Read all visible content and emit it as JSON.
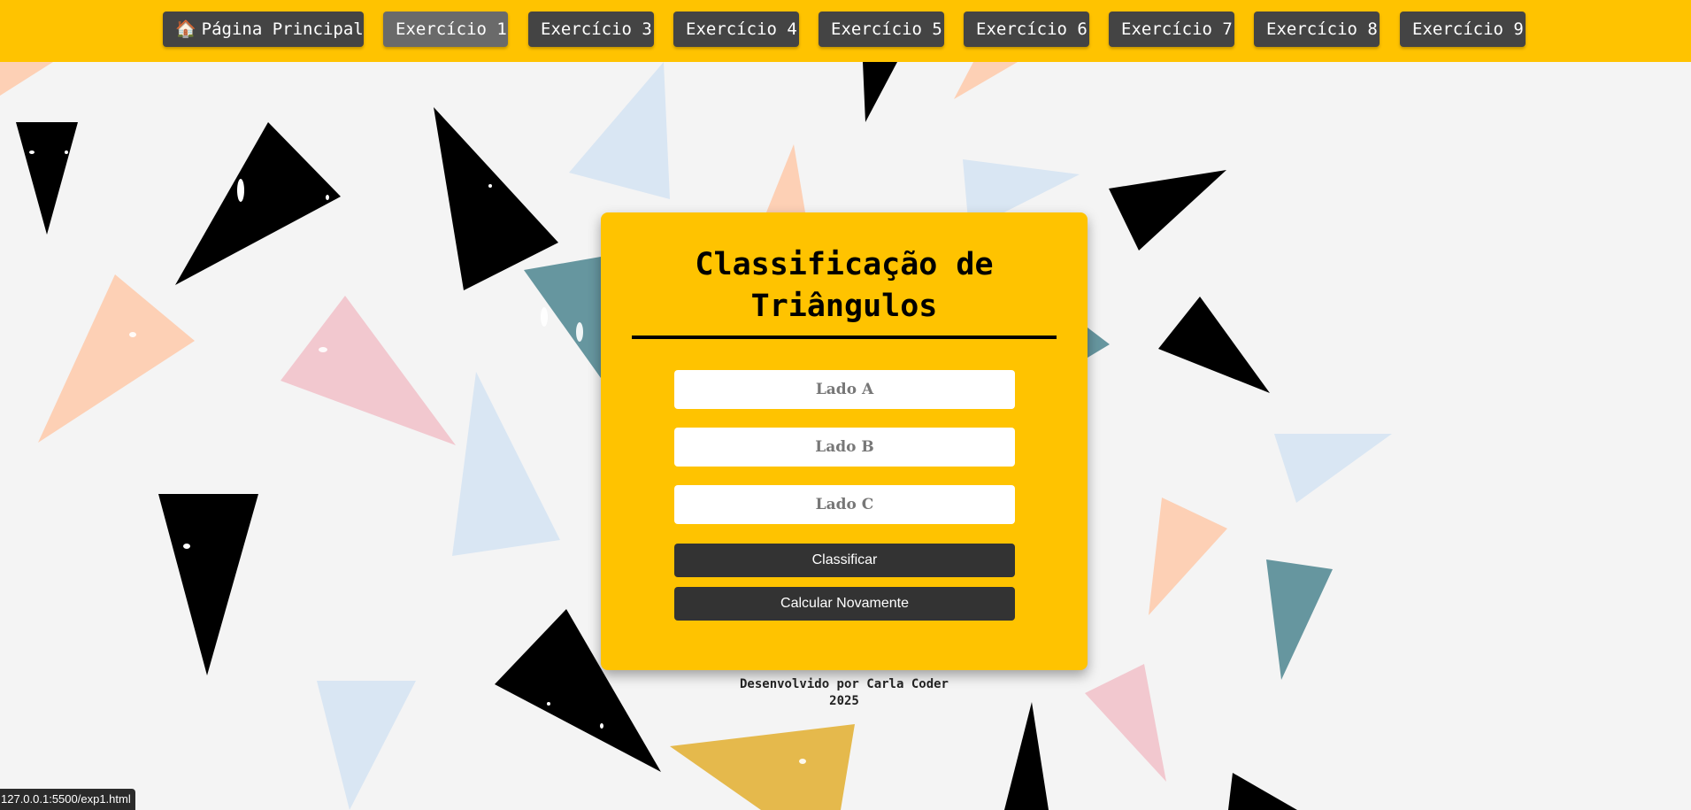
{
  "nav": {
    "home_icon": "🏠",
    "home_label": "Página Principal",
    "items": [
      {
        "label": "Exercício 1",
        "active": true
      },
      {
        "label": "Exercício 3"
      },
      {
        "label": "Exercício 4"
      },
      {
        "label": "Exercício 5"
      },
      {
        "label": "Exercício 6"
      },
      {
        "label": "Exercício 7"
      },
      {
        "label": "Exercício 8"
      },
      {
        "label": "Exercício 9"
      }
    ]
  },
  "card": {
    "title_line1": "Classificação de",
    "title_line2": "Triângulos",
    "fields": [
      {
        "placeholder": "Lado A",
        "value": ""
      },
      {
        "placeholder": "Lado B",
        "value": ""
      },
      {
        "placeholder": "Lado C",
        "value": ""
      }
    ],
    "classify_label": "Classificar",
    "reset_label": "Calcular Novamente"
  },
  "footer": {
    "credit": "Desenvolvido por Carla Coder",
    "year": "2025"
  },
  "status_bar": {
    "url": "127.0.0.1:5500/exp1.html"
  },
  "colors": {
    "accent": "#ffc300",
    "button_dark": "#333333",
    "nav_button": "#444444",
    "nav_button_active": "#6a6a6a",
    "background": "#f4f4f4",
    "triangle_black": "#000000",
    "triangle_peach": "#fdd0b5",
    "triangle_pink": "#f2c8cf",
    "triangle_lightblue": "#d9e6f3",
    "triangle_teal": "#66969f",
    "triangle_gold": "#e5b94c"
  }
}
